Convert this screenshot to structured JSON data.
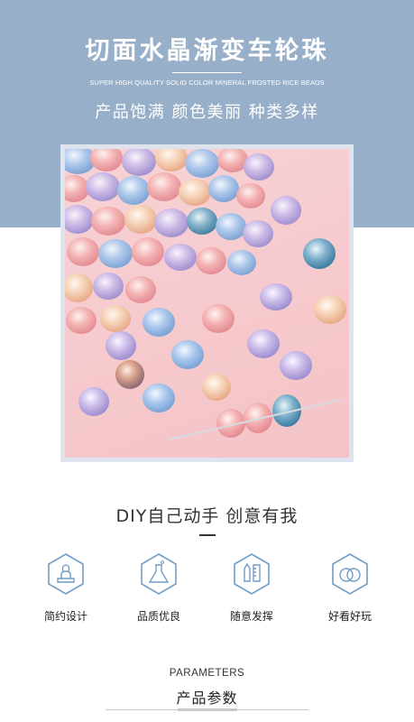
{
  "banner": {
    "title": "切面水晶渐变车轮珠",
    "subtitle_en": "SUPER HIGH QUALITY SOLID COLOR MINERAL FROSTED RICE BEADS",
    "tagline": "产品饱满 颜色美丽 种类多样",
    "background_color": "#98afc9"
  },
  "slogan": {
    "text": "DIY自己动手 创意有我"
  },
  "features": [
    {
      "icon": "stamp-icon",
      "label": "简约设计"
    },
    {
      "icon": "flask-icon",
      "label": "品质优良"
    },
    {
      "icon": "pencil-ruler-icon",
      "label": "随意发挥"
    },
    {
      "icon": "rings-icon",
      "label": "好看好玩"
    }
  ],
  "parameters": {
    "heading_en": "PARAMETERS",
    "heading_cn": "产品参数"
  },
  "colors": {
    "icon_stroke": "#6f9cc8",
    "text_dark": "#222222"
  }
}
